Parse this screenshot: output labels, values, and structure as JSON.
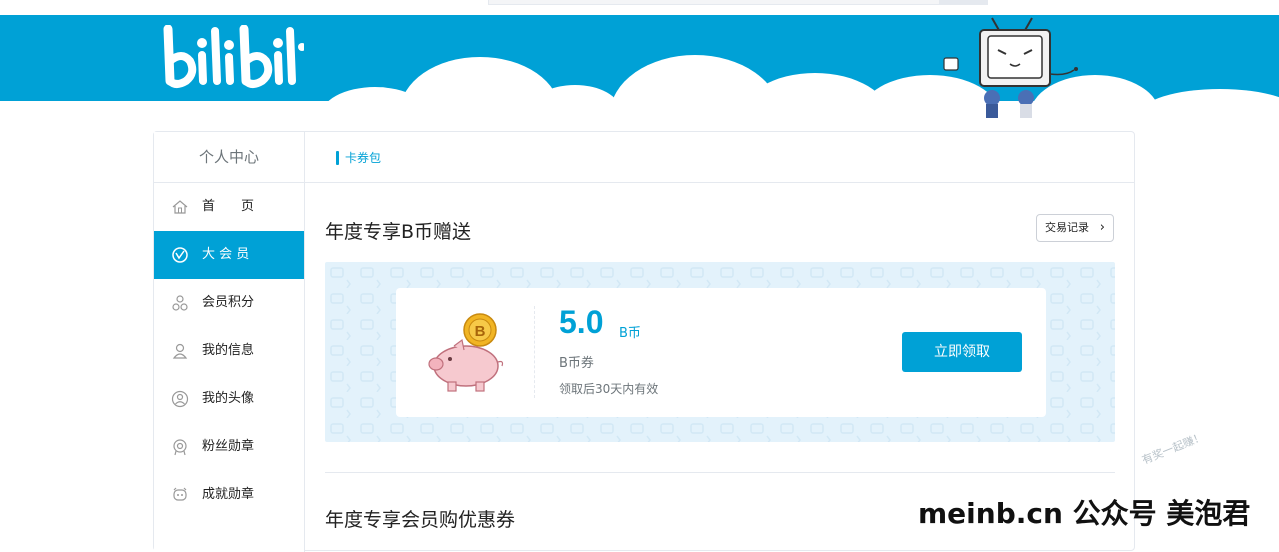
{
  "header": {
    "logo_text": "bilibili"
  },
  "sidebar": {
    "title": "个人中心",
    "items": [
      {
        "label": "首　　页",
        "icon": "home-icon"
      },
      {
        "label": "大 会 员",
        "icon": "vip-icon",
        "active": true
      },
      {
        "label": "会员积分",
        "icon": "points-icon"
      },
      {
        "label": "我的信息",
        "icon": "user-icon"
      },
      {
        "label": "我的头像",
        "icon": "avatar-icon"
      },
      {
        "label": "粉丝勋章",
        "icon": "fan-medal-icon"
      },
      {
        "label": "成就勋章",
        "icon": "achievement-icon"
      }
    ]
  },
  "main": {
    "tab_title": "卡券包",
    "section1_title": "年度专享B币赠送",
    "record_button": "交易记录",
    "coupon": {
      "amount": "5.0",
      "unit": "B币",
      "type": "B币券",
      "validity": "领取后30天内有效",
      "claim_button": "立即领取"
    },
    "section2_title": "年度专享会员购优惠券"
  },
  "overlay": {
    "watermark": "meinb.cn  公众号 美泡君",
    "stamp": "有奖一起赚！"
  },
  "colors": {
    "brand": "#00a1d6",
    "coupon_bg": "#e3f2fb"
  }
}
